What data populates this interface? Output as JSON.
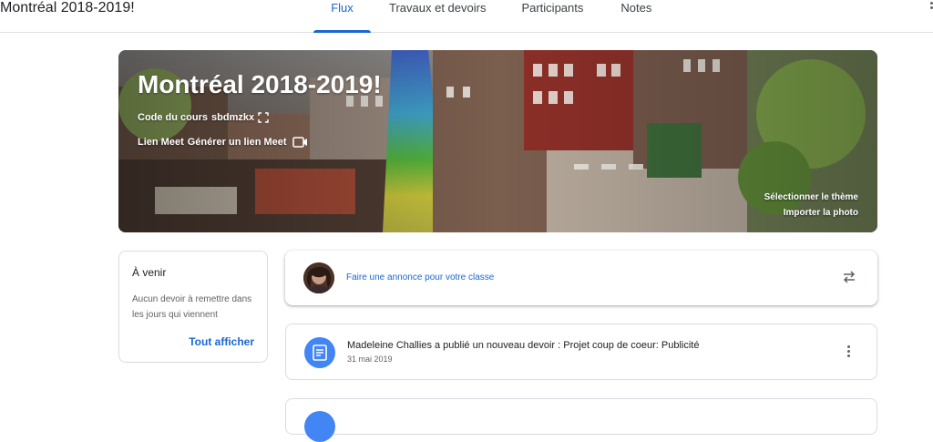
{
  "app": {
    "title": "Montréal 2018-2019!"
  },
  "tabs": [
    {
      "label": "Flux",
      "active": true
    },
    {
      "label": "Travaux et devoirs",
      "active": false
    },
    {
      "label": "Participants",
      "active": false
    },
    {
      "label": "Notes",
      "active": false
    }
  ],
  "banner": {
    "title": "Montréal 2018-2019!",
    "code_label": "Code du cours",
    "code_value": "sbdmzkx",
    "meet_label": "Lien Meet",
    "meet_link": "Générer un lien Meet",
    "select_theme": "Sélectionner le thème",
    "import_photo": "Importer la photo"
  },
  "upcoming": {
    "title": "À venir",
    "text": "Aucun devoir à remettre dans les jours qui viennent",
    "link": "Tout afficher"
  },
  "announce": {
    "placeholder": "Faire une annonce pour votre classe"
  },
  "posts": [
    {
      "title": "Madeleine Challies a publié un nouveau devoir : Projet coup de coeur: Publicité",
      "date": "31 mai 2019"
    }
  ],
  "colors": {
    "accent": "#1967d2",
    "post_icon": "#4285f4"
  },
  "icons": {
    "code_expand": "fullscreen-icon",
    "meet": "video-camera-icon",
    "repost": "repost-arrows-icon",
    "assignment": "assignment-icon",
    "more": "more-vert-icon"
  }
}
